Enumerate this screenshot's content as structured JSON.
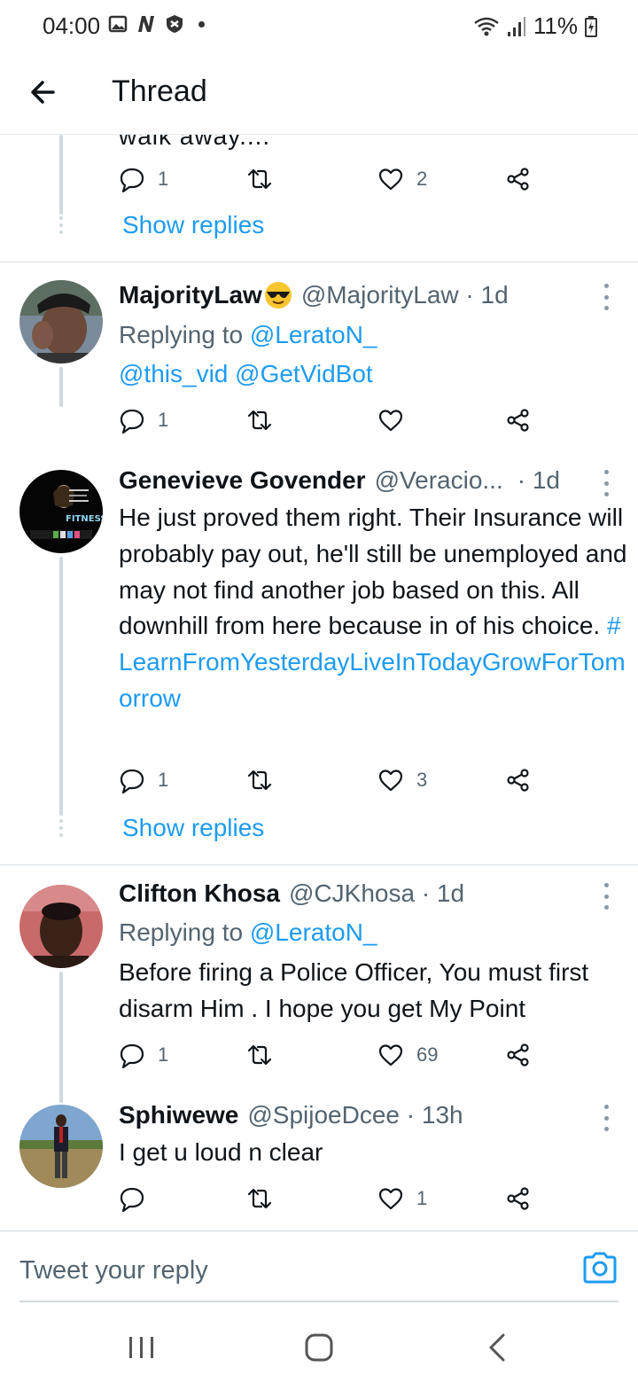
{
  "status_bar": {
    "time": "04:00",
    "battery": "11%",
    "icons": [
      "gallery-icon",
      "n-app-icon",
      "shield-icon",
      "dot",
      "wifi-icon",
      "signal-icon",
      "battery-icon"
    ]
  },
  "header": {
    "title": "Thread"
  },
  "top_fragment": {
    "cut_text": "walk away....",
    "replies": "1",
    "retweets": "",
    "likes": "2",
    "show_replies": "Show replies"
  },
  "tweets": [
    {
      "name": "MajorityLaw",
      "emoji": "smiling-face-with-sunglasses",
      "handle": "@MajorityLaw · 1d",
      "replying_prefix": "Replying to ",
      "replying_to": "@LeratoN_",
      "mentions": "@this_vid @GetVidBot",
      "replies": "1",
      "retweets": "",
      "likes": ""
    },
    {
      "name": "Genevieve Govender",
      "handle": "@Veracio...",
      "time": "· 1d",
      "text": "He just proved them right. Their Insurance will probably pay out, he'll still be unemployed and may not find another job based on this. All downhill from here because in of his choice.",
      "hashtag": "#LearnFromYesterdayLiveInTodayGrowForTomorrow",
      "replies": "1",
      "retweets": "",
      "likes": "3",
      "show_replies": "Show replies"
    },
    {
      "name": "Clifton Khosa",
      "handle": "@CJKhosa · 1d",
      "replying_prefix": "Replying to ",
      "replying_to": "@LeratoN_",
      "text": "Before firing a Police Officer, You must first disarm Him . I hope you get My Point",
      "replies": "1",
      "retweets": "",
      "likes": "69"
    },
    {
      "name": "Sphiwewe",
      "handle": "@SpijoeDcee · 13h",
      "text": "I get u loud n clear",
      "replies": "",
      "retweets": "",
      "likes": "1"
    }
  ],
  "reply_bar": {
    "placeholder": "Tweet your reply"
  },
  "colors": {
    "link": "#1d9bf0",
    "secondary": "#536471",
    "text": "#0f1419",
    "line": "#cfd9de"
  }
}
